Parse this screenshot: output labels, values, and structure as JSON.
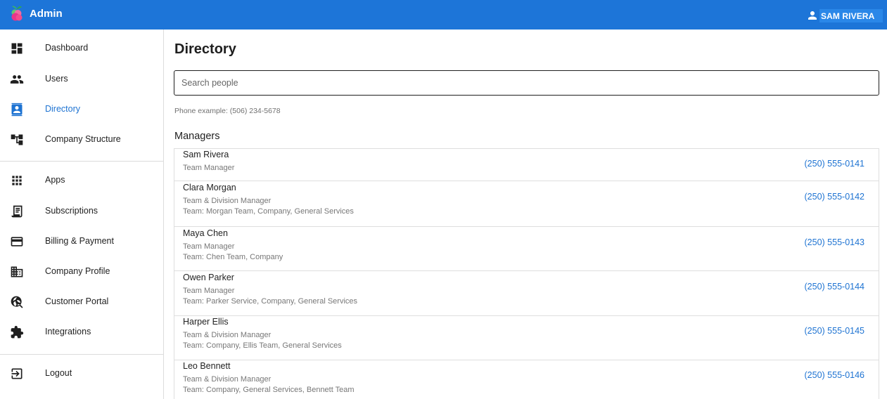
{
  "header": {
    "title": "Admin",
    "user_name": "SAM RIVERA"
  },
  "sidebar": {
    "items": [
      {
        "label": "Dashboard",
        "icon": "dashboard-icon"
      },
      {
        "label": "Users",
        "icon": "people-icon"
      },
      {
        "label": "Directory",
        "icon": "contact-card-icon",
        "active": true
      },
      {
        "label": "Company Structure",
        "icon": "hierarchy-icon"
      },
      {
        "label": "Apps",
        "icon": "apps-grid-icon"
      },
      {
        "label": "Subscriptions",
        "icon": "receipt-icon"
      },
      {
        "label": "Billing & Payment",
        "icon": "credit-card-icon"
      },
      {
        "label": "Company Profile",
        "icon": "building-icon"
      },
      {
        "label": "Customer Portal",
        "icon": "portal-search-icon"
      },
      {
        "label": "Integrations",
        "icon": "puzzle-icon"
      },
      {
        "label": "Logout",
        "icon": "logout-icon"
      }
    ]
  },
  "main": {
    "title": "Directory",
    "search_placeholder": "Search people",
    "phone_hint": "Phone example: (506) 234-5678",
    "section_title": "Managers",
    "managers": [
      {
        "name": "Sam Rivera",
        "role": "Team Manager",
        "team": "",
        "phone": "(250) 555-0141"
      },
      {
        "name": "Clara Morgan",
        "role": "Team & Division Manager",
        "team": "Team: Morgan Team, Company, General Services",
        "phone": "(250) 555-0142"
      },
      {
        "name": "Maya Chen",
        "role": "Team Manager",
        "team": "Team: Chen Team, Company",
        "phone": "(250) 555-0143"
      },
      {
        "name": "Owen Parker",
        "role": "Team Manager",
        "team": "Team: Parker Service, Company, General Services",
        "phone": "(250) 555-0144"
      },
      {
        "name": "Harper Ellis",
        "role": "Team & Division Manager",
        "team": "Team: Company, Ellis Team, General Services",
        "phone": "(250) 555-0145"
      },
      {
        "name": "Leo Bennett",
        "role": "Team & Division Manager",
        "team": "Team: Company, General Services, Bennett Team",
        "phone": "(250) 555-0146"
      }
    ]
  },
  "colors": {
    "appbar": "#1d75d8",
    "accent": "#1e73d2"
  }
}
